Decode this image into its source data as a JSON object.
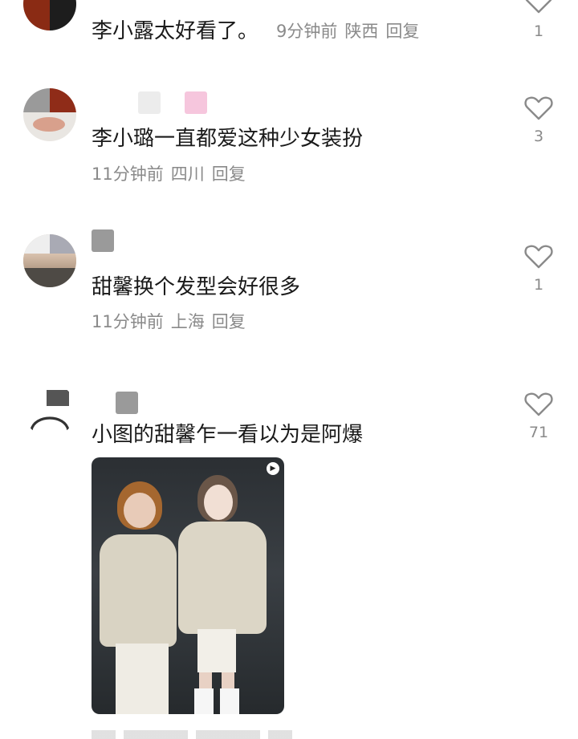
{
  "comments": [
    {
      "text": "李小露太好看了。",
      "time": "9分钟前",
      "location": "陕西",
      "reply": "回复",
      "likes": "1"
    },
    {
      "text": "李小璐一直都爱这种少女装扮",
      "time": "11分钟前",
      "location": "四川",
      "reply": "回复",
      "likes": "3"
    },
    {
      "text": "甜馨换个发型会好很多",
      "time": "11分钟前",
      "location": "上海",
      "reply": "回复",
      "likes": "1"
    },
    {
      "text": "小图的甜馨乍一看以为是阿爆",
      "likes": "71"
    }
  ],
  "icons": {
    "like": "heart-outline-icon",
    "play": "play-icon"
  },
  "colors": {
    "text": "#1a1a1a",
    "meta": "#8a8a8a",
    "heart": "#8a8a8a"
  }
}
